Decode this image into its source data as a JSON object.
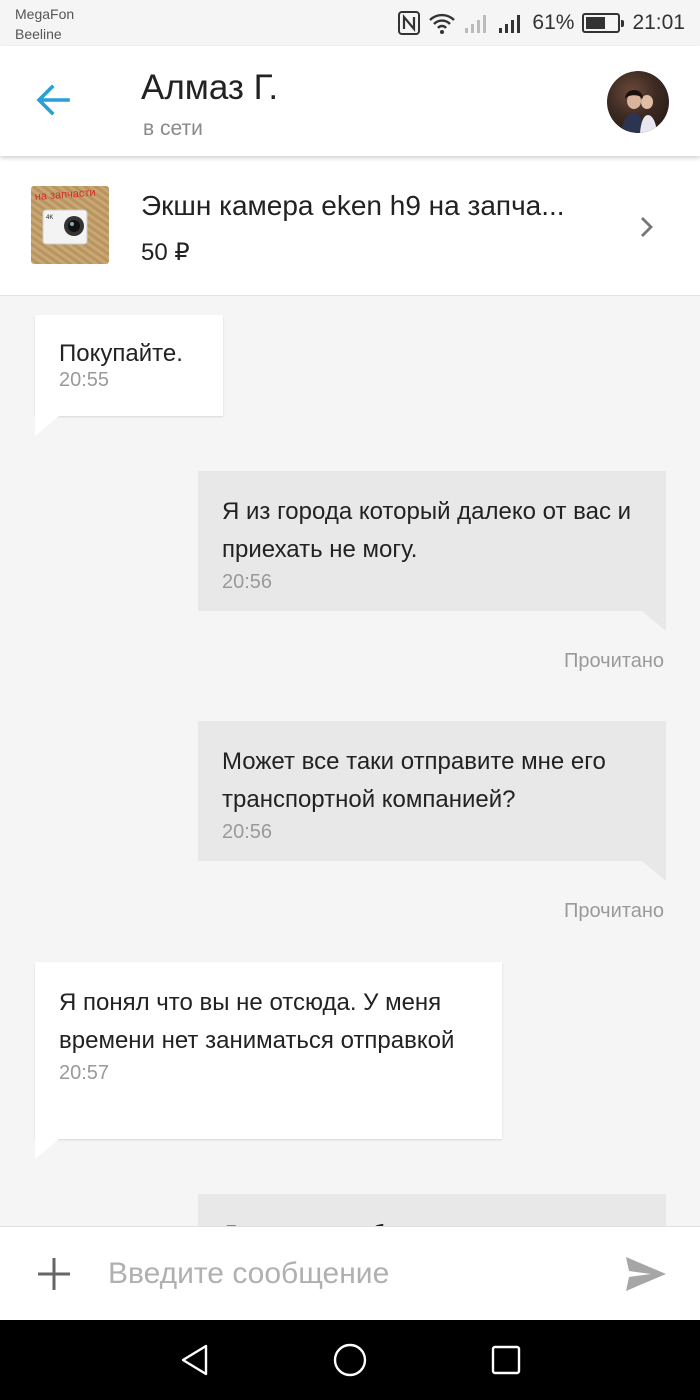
{
  "status_bar": {
    "carrier_1": "MegaFon",
    "carrier_2": "Beeline",
    "battery_percent": "61%",
    "battery_level": 0.61,
    "time": "21:01",
    "icons": [
      "nfc-icon",
      "wifi-icon",
      "signal-icon",
      "signal-icon",
      "battery-icon"
    ]
  },
  "header": {
    "contact_name": "Алмаз Г.",
    "contact_status": "в сети",
    "back_icon": "arrow-left-icon",
    "accent_color": "#2a9fd6"
  },
  "product": {
    "title": "Экшн камера eken h9 на запча...",
    "price": "50 ₽",
    "thumb_label": "на запчасти",
    "thumb_badge": "4K"
  },
  "messages": [
    {
      "direction": "incoming",
      "text": "Покупайте.",
      "time": "20:55"
    },
    {
      "direction": "outgoing",
      "text": "Я из города который далеко от вас и приехать не могу.",
      "time": "20:56",
      "status": "Прочитано"
    },
    {
      "direction": "outgoing",
      "text": "Может все таки отправите мне его транспортной компанией?",
      "time": "20:56",
      "status": "Прочитано"
    },
    {
      "direction": "incoming",
      "text": "Я понял что вы не отсюда. У меня времени нет заниматься отправкой",
      "time": "20:57"
    },
    {
      "direction": "outgoing",
      "text": "Ладно, попробую с кем то",
      "time": ""
    }
  ],
  "input": {
    "placeholder": "Введите сообщение",
    "value": ""
  },
  "colors": {
    "incoming_bubble": "#ffffff",
    "outgoing_bubble": "#e8e8e8",
    "background": "#f5f5f5"
  }
}
